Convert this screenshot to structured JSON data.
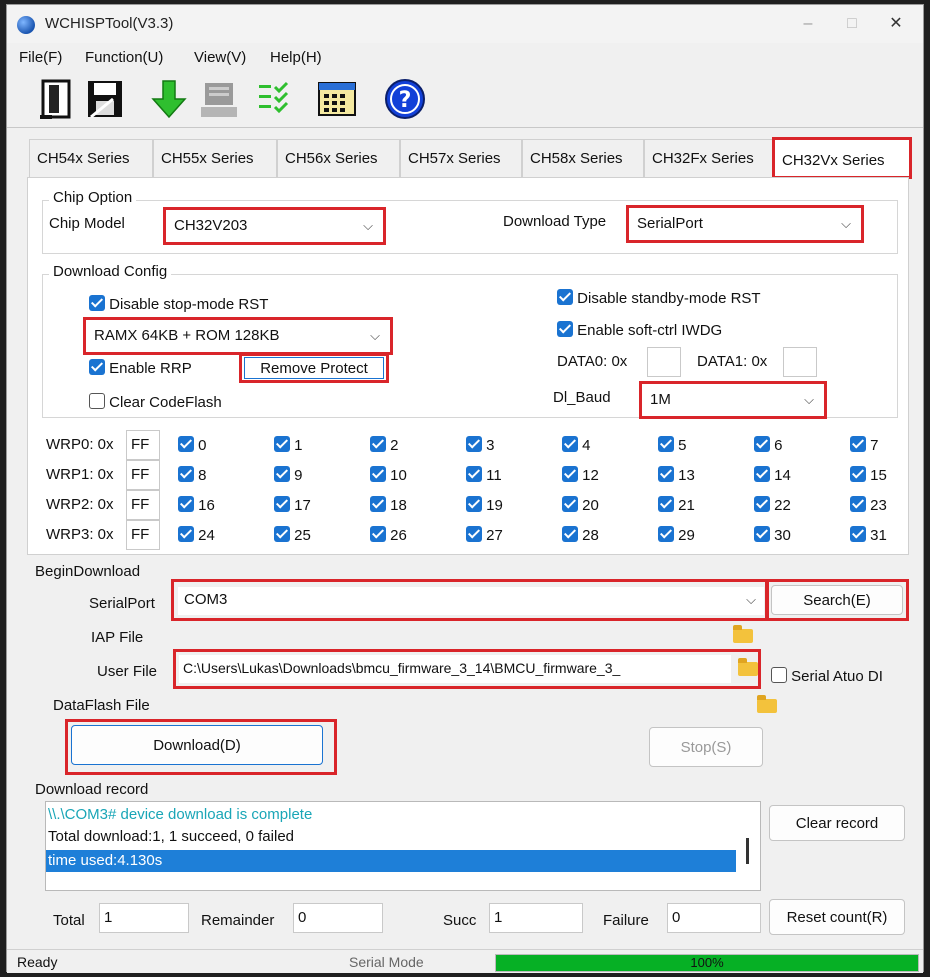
{
  "window": {
    "title": "WCHISPTool(V3.3)",
    "minimize": "–",
    "maximize": "□",
    "close": "✕"
  },
  "menu": [
    "File(F)",
    "Function(U)",
    "View(V)",
    "Help(H)"
  ],
  "toolbar": [
    "open-door-icon",
    "save-disk-icon",
    "download-arrow-icon",
    "device-icon",
    "checklist-icon",
    "keypad-icon",
    "help-icon"
  ],
  "tabs": [
    "CH54x Series",
    "CH55x Series",
    "CH56x Series",
    "CH57x Series",
    "CH58x Series",
    "CH32Fx Series",
    "CH32Vx Series"
  ],
  "chip_option": {
    "title": "Chip Option",
    "chip_model_label": "Chip Model",
    "chip_model_value": "CH32V203",
    "download_type_label": "Download Type",
    "download_type_value": "SerialPort"
  },
  "download_config": {
    "title": "Download Config",
    "disable_stop_rst": "Disable stop-mode RST",
    "ram_rom_value": "RAMX 64KB + ROM 128KB",
    "enable_rrp": "Enable RRP",
    "remove_protect": "Remove Protect",
    "clear_codeflash": "Clear CodeFlash",
    "disable_standby_rst": "Disable standby-mode RST",
    "enable_softctrl_iwdg": "Enable soft-ctrl IWDG",
    "data0_label": "DATA0: 0x",
    "data1_label": "DATA1: 0x",
    "dl_baud_label": "Dl_Baud",
    "dl_baud_value": "1M"
  },
  "wrp": {
    "rows": [
      {
        "label": "WRP0: 0x",
        "value": "FF",
        "bits": [
          "0",
          "1",
          "2",
          "3",
          "4",
          "5",
          "6",
          "7"
        ]
      },
      {
        "label": "WRP1: 0x",
        "value": "FF",
        "bits": [
          "8",
          "9",
          "10",
          "11",
          "12",
          "13",
          "14",
          "15"
        ]
      },
      {
        "label": "WRP2: 0x",
        "value": "FF",
        "bits": [
          "16",
          "17",
          "18",
          "19",
          "20",
          "21",
          "22",
          "23"
        ]
      },
      {
        "label": "WRP3: 0x",
        "value": "FF",
        "bits": [
          "24",
          "25",
          "26",
          "27",
          "28",
          "29",
          "30",
          "31"
        ]
      }
    ]
  },
  "begin_download": {
    "title": "BeginDownload",
    "serialport_label": "SerialPort",
    "serialport_value": "COM3",
    "search_button": "Search(E)",
    "iap_label": "IAP File",
    "user_label": "User File",
    "user_value": "C:\\Users\\Lukas\\Downloads\\bmcu_firmware_3_14\\BMCU_firmware_3_",
    "dataflash_label": "DataFlash File",
    "serial_auto_di": "Serial Atuo DI",
    "download_button": "Download(D)",
    "stop_button": "Stop(S)"
  },
  "record": {
    "title": "Download record",
    "lines": [
      "\\\\.\\COM3# device download is complete",
      "Total download:1, 1 succeed, 0 failed",
      "time used:4.130s"
    ],
    "clear_button": "Clear record"
  },
  "counts": {
    "total_label": "Total",
    "total_value": "1",
    "remainder_label": "Remainder",
    "remainder_value": "0",
    "succ_label": "Succ",
    "succ_value": "1",
    "failure_label": "Failure",
    "failure_value": "0",
    "reset_button": "Reset count(R)"
  },
  "status": {
    "left": "Ready",
    "mode": "Serial Mode",
    "progress_text": "100%",
    "progress": 1.0
  },
  "colors": {
    "highlight_red": "#d9252a",
    "check_blue": "#1a73d1",
    "record_teal": "#1aa6b7",
    "selection_blue": "#1e7fd8",
    "progress_green": "#06b025"
  }
}
